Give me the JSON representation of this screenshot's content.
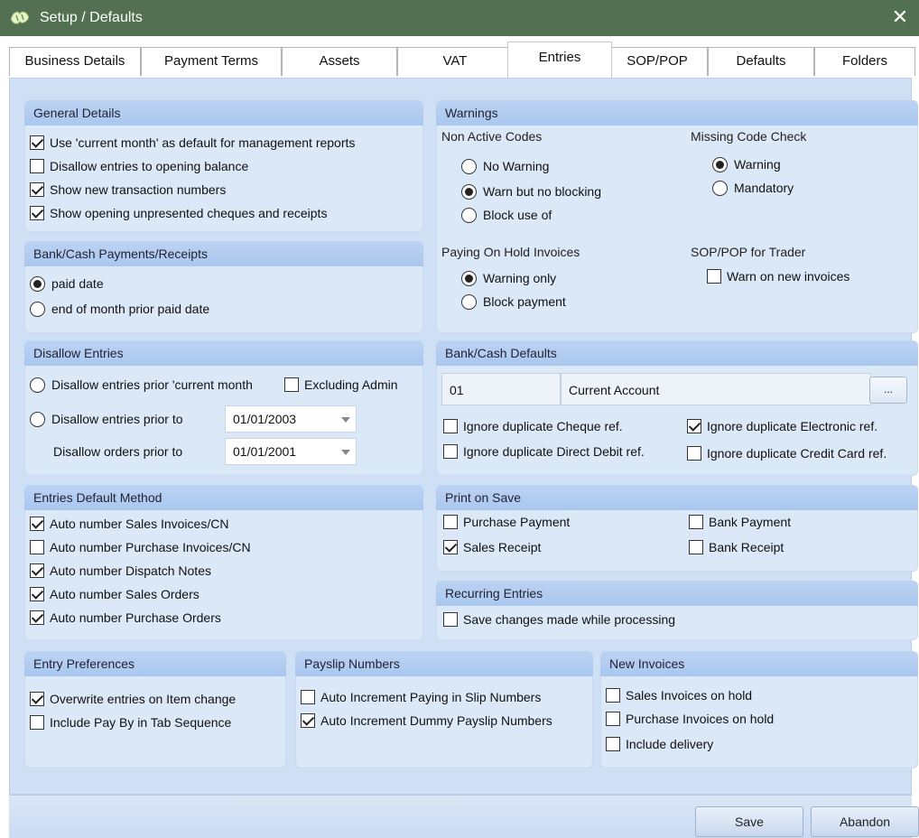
{
  "window": {
    "title": "Setup / Defaults",
    "close_glyph": "✕"
  },
  "tabs": [
    {
      "label": "Business Details"
    },
    {
      "label": "Payment Terms"
    },
    {
      "label": "Assets"
    },
    {
      "label": "VAT"
    },
    {
      "label": "Entries",
      "active": true
    },
    {
      "label": "SOP/POP"
    },
    {
      "label": "Defaults"
    },
    {
      "label": "Folders"
    }
  ],
  "general_details": {
    "title": "General Details",
    "items": [
      {
        "label": "Use 'current month' as default for management reports",
        "checked": true
      },
      {
        "label": "Disallow entries to opening balance",
        "checked": false
      },
      {
        "label": "Show new transaction numbers",
        "checked": true
      },
      {
        "label": "Show opening unpresented cheques and receipts",
        "checked": true
      }
    ]
  },
  "bank_cash_payments": {
    "title": "Bank/Cash Payments/Receipts",
    "options": [
      {
        "label": "paid date",
        "selected": true
      },
      {
        "label": "end of month prior paid date",
        "selected": false
      }
    ]
  },
  "disallow_entries": {
    "title": "Disallow Entries",
    "prior_current_month": "Disallow entries prior 'current month",
    "excluding_admin": "Excluding Admin",
    "prior_to": "Disallow entries prior to",
    "prior_to_date": "01/01/2003",
    "orders_prior_to": "Disallow orders prior to",
    "orders_prior_to_date": "01/01/2001"
  },
  "entries_default_method": {
    "title": "Entries Default Method",
    "items": [
      {
        "label": "Auto number Sales Invoices/CN",
        "checked": true
      },
      {
        "label": "Auto number Purchase Invoices/CN",
        "checked": false
      },
      {
        "label": "Auto number Dispatch Notes",
        "checked": true
      },
      {
        "label": "Auto number Sales Orders",
        "checked": true
      },
      {
        "label": "Auto number Purchase Orders",
        "checked": true
      }
    ]
  },
  "warnings": {
    "title": "Warnings",
    "non_active_codes": {
      "label": "Non Active Codes",
      "options": [
        {
          "label": "No Warning",
          "selected": false
        },
        {
          "label": "Warn but no blocking",
          "selected": true
        },
        {
          "label": "Block use of",
          "selected": false
        }
      ]
    },
    "missing_code_check": {
      "label": "Missing Code Check",
      "options": [
        {
          "label": "Warning",
          "selected": true
        },
        {
          "label": "Mandatory",
          "selected": false
        }
      ]
    },
    "paying_on_hold": {
      "label": "Paying On Hold Invoices",
      "options": [
        {
          "label": "Warning only",
          "selected": true
        },
        {
          "label": "Block payment",
          "selected": false
        }
      ]
    },
    "sop_pop_trader": {
      "label": "SOP/POP for Trader",
      "warn_new_invoices": "Warn on new invoices"
    }
  },
  "bank_cash_defaults": {
    "title": "Bank/Cash Defaults",
    "code": "01",
    "account_name": "Current Account",
    "browse_label": "...",
    "ignore_cheque": "Ignore duplicate Cheque ref.",
    "ignore_electronic": "Ignore duplicate Electronic ref.",
    "ignore_direct_debit": "Ignore duplicate Direct Debit ref.",
    "ignore_credit_card": "Ignore duplicate Credit Card ref."
  },
  "print_on_save": {
    "title": "Print on Save",
    "purchase_payment": "Purchase Payment",
    "bank_payment": "Bank Payment",
    "sales_receipt": "Sales Receipt",
    "bank_receipt": "Bank Receipt"
  },
  "recurring_entries": {
    "title": "Recurring Entries",
    "save_changes": "Save changes made while processing"
  },
  "entry_preferences": {
    "title": "Entry Preferences",
    "overwrite": "Overwrite entries on Item change",
    "include_pay_by": "Include Pay By in Tab Sequence"
  },
  "payslip_numbers": {
    "title": "Payslip Numbers",
    "auto_paying_in": "Auto Increment Paying in Slip Numbers",
    "auto_dummy": "Auto Increment Dummy Payslip Numbers"
  },
  "new_invoices": {
    "title": "New Invoices",
    "sales_on_hold": "Sales Invoices on hold",
    "purchase_on_hold": "Purchase Invoices on hold",
    "include_delivery": "Include delivery"
  },
  "buttons": {
    "save": "Save",
    "abandon": "Abandon"
  }
}
